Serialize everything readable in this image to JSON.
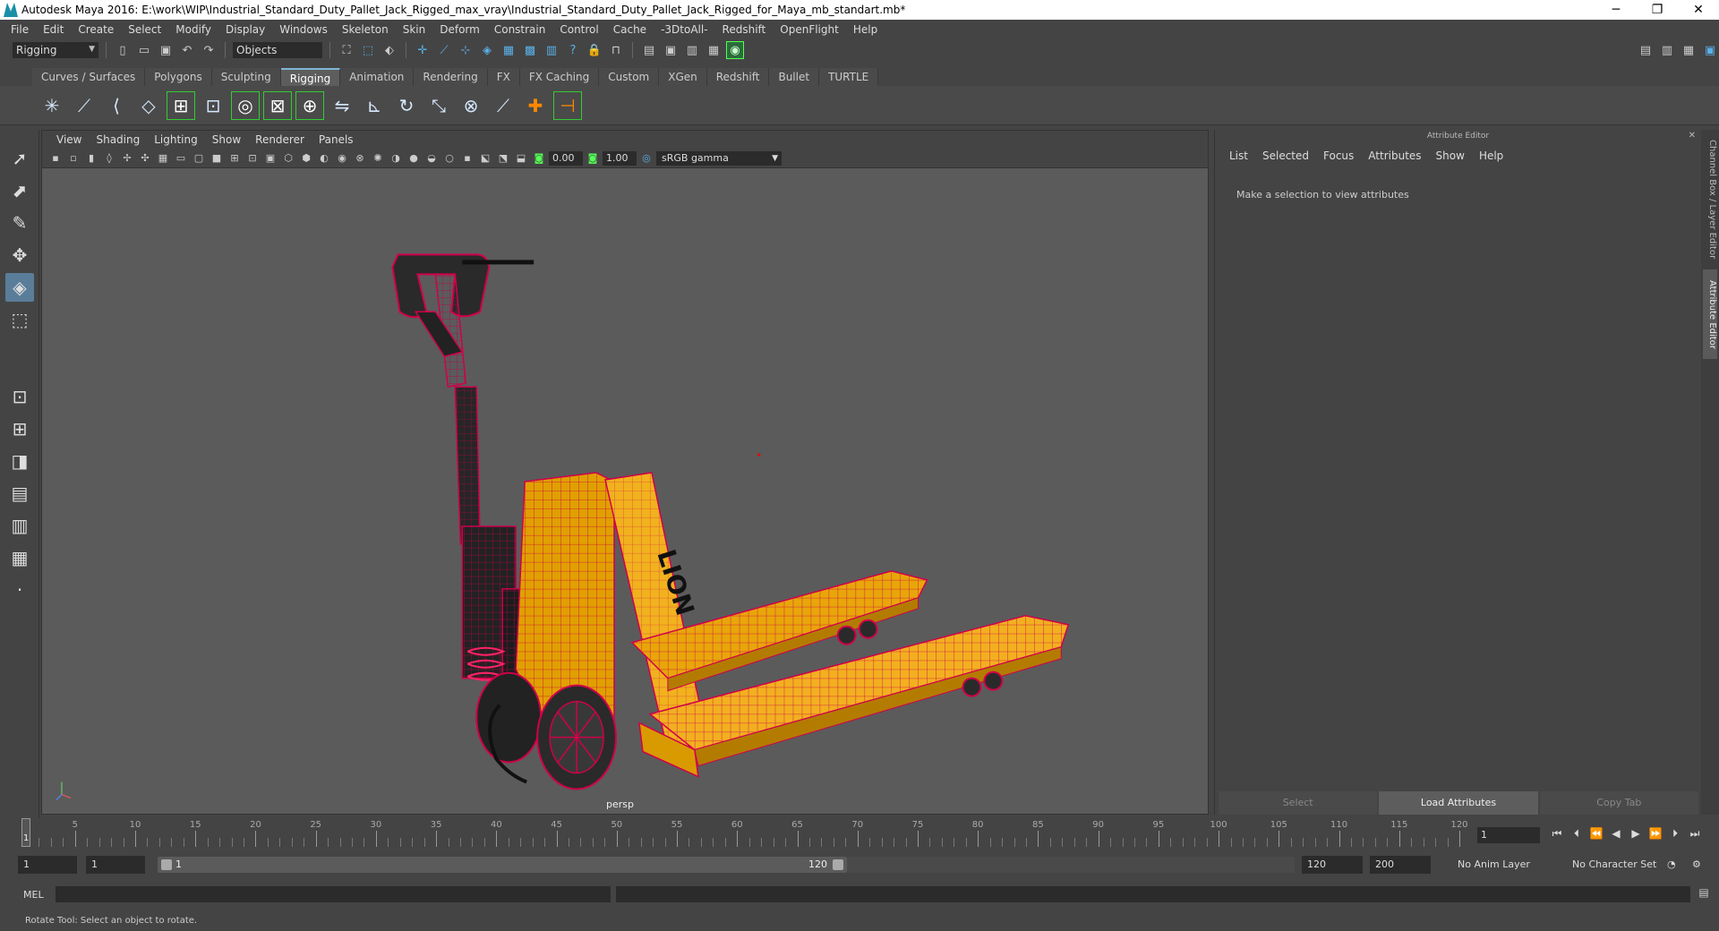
{
  "window": {
    "title": "Autodesk Maya 2016: E:\\work\\WIP\\Industrial_Standard_Duty_Pallet_Jack_Rigged_max_vray\\Industrial_Standard_Duty_Pallet_Jack_Rigged_for_Maya_mb_standart.mb*",
    "minimize": "─",
    "restore": "❐",
    "close": "✕"
  },
  "menubar": [
    "File",
    "Edit",
    "Create",
    "Select",
    "Modify",
    "Display",
    "Windows",
    "Skeleton",
    "Skin",
    "Deform",
    "Constrain",
    "Control",
    "Cache",
    "-3DtoAll-",
    "Redshift",
    "OpenFlight",
    "Help"
  ],
  "statusline": {
    "menuset": "Rigging",
    "selection_mode": "Objects"
  },
  "shelf": {
    "tabs": [
      "Curves / Surfaces",
      "Polygons",
      "Sculpting",
      "Rigging",
      "Animation",
      "Rendering",
      "FX",
      "FX Caching",
      "Custom",
      "XGen",
      "Redshift",
      "Bullet",
      "TURTLE"
    ],
    "active_tab": "Rigging"
  },
  "viewport": {
    "menu": [
      "View",
      "Shading",
      "Lighting",
      "Show",
      "Renderer",
      "Panels"
    ],
    "exposure": "0.00",
    "gamma": "1.00",
    "color_space": "sRGB gamma",
    "camera": "persp",
    "decal_text": "LION"
  },
  "attribute_editor": {
    "header": "Attribute Editor",
    "menu": [
      "List",
      "Selected",
      "Focus",
      "Attributes",
      "Show",
      "Help"
    ],
    "message": "Make a selection to view attributes",
    "buttons": {
      "select": "Select",
      "load": "Load Attributes",
      "copy": "Copy Tab"
    }
  },
  "side_tabs": {
    "channel_box": "Channel Box / Layer Editor",
    "attribute_editor": "Attribute Editor"
  },
  "timeline": {
    "labels": [
      "5",
      "10",
      "15",
      "20",
      "25",
      "30",
      "35",
      "40",
      "45",
      "50",
      "55",
      "60",
      "65",
      "70",
      "75",
      "80",
      "85",
      "90",
      "95",
      "100",
      "105",
      "110",
      "115",
      "120"
    ],
    "current_frame": "1",
    "current_frame_field": "1"
  },
  "range": {
    "start": "1",
    "playback_start": "1",
    "slider_start": "1",
    "slider_end": "120",
    "playback_end": "120",
    "end": "200",
    "anim_layer": "No Anim Layer",
    "character_set": "No Character Set"
  },
  "command_line": {
    "label": "MEL"
  },
  "help_line": "Rotate Tool: Select an object to rotate."
}
